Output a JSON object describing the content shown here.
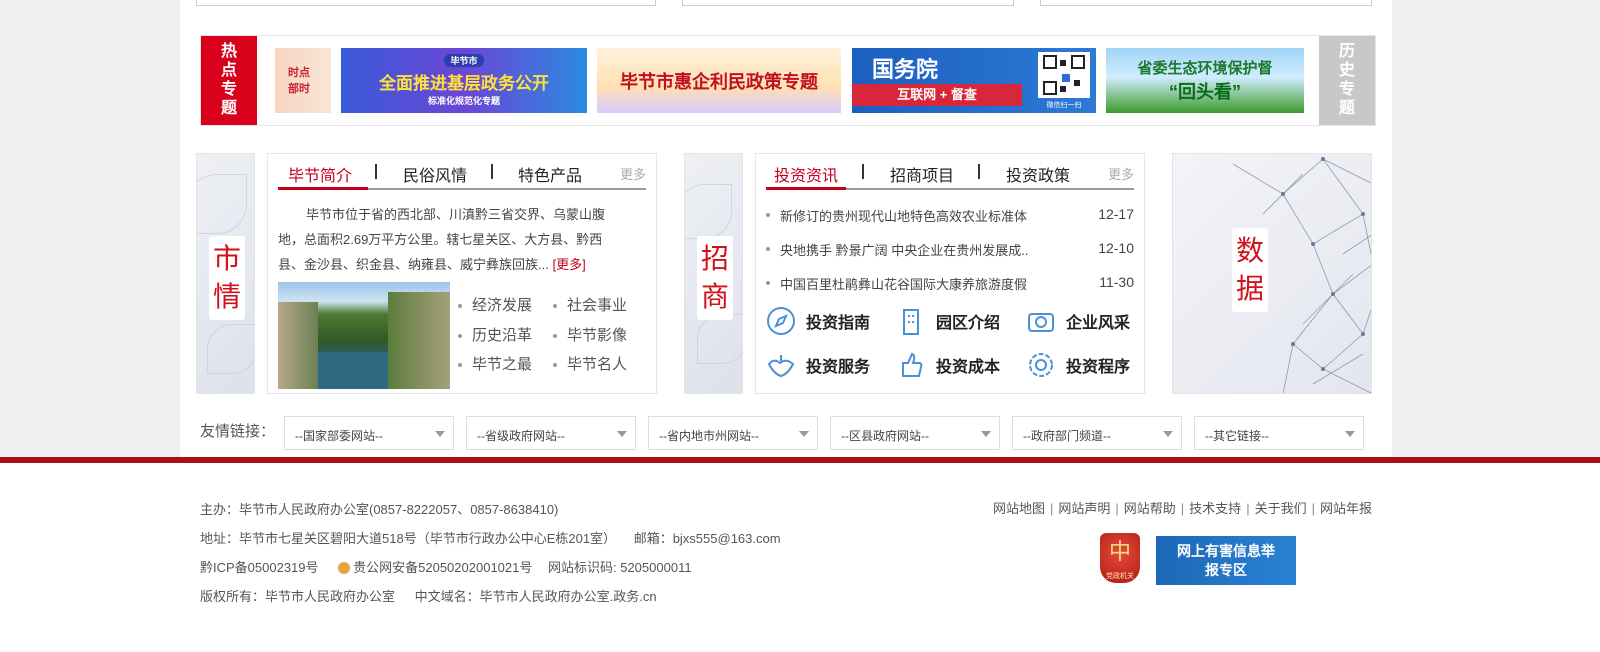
{
  "hot": {
    "label": "热点专题",
    "history_label": "历史专题",
    "banners": [
      {
        "text": "时点 部时"
      },
      {
        "tag": "毕节市",
        "text": "全面推进基层政务公开",
        "sub": "标准化规范化专题"
      },
      {
        "text": "毕节市惠企利民政策专题"
      },
      {
        "text": "国务院",
        "sub": "互联网 + 督查",
        "qr_note": "微信扫一扫"
      },
      {
        "text": "省委生态环境保护督",
        "sub": "“回头看”"
      }
    ]
  },
  "market": {
    "tag": "市情",
    "tabs": [
      "毕节简介",
      "民俗风情",
      "特色产品"
    ],
    "more": "更多",
    "intro": "毕节市位于省的西北部、川滇黔三省交界、乌蒙山腹地，总面积2.69万平方公里。辖七星关区、大方县、黔西县、金沙县、织金县、纳雍县、威宁彝族回族...",
    "intro_more": "[更多]",
    "links": [
      "经济发展",
      "社会事业",
      "历史沿革",
      "毕节影像",
      "毕节之最",
      "毕节名人"
    ]
  },
  "invest": {
    "tag": "招商",
    "tabs": [
      "投资资讯",
      "招商项目",
      "投资政策"
    ],
    "more": "更多",
    "news": [
      {
        "title": "新修订的贵州现代山地特色高效农业标准体",
        "date": "12-17"
      },
      {
        "title": "央地携手 黔景广阔 中央企业在贵州发展成..",
        "date": "12-10"
      },
      {
        "title": "中国百里杜鹃彝山花谷国际大康养旅游度假",
        "date": "11-30"
      }
    ],
    "shortcuts": [
      {
        "label": "投资指南",
        "icon": "compass-icon"
      },
      {
        "label": "园区介绍",
        "icon": "building-icon"
      },
      {
        "label": "企业风采",
        "icon": "camera-icon"
      },
      {
        "label": "投资服务",
        "icon": "handshake-icon"
      },
      {
        "label": "投资成本",
        "icon": "thumbs-up-icon"
      },
      {
        "label": "投资程序",
        "icon": "gear-icon"
      }
    ]
  },
  "data_section": {
    "tag": "数据"
  },
  "friend_links": {
    "label": "友情链接：",
    "selects": [
      "--国家部委网站--",
      "--省级政府网站--",
      "--省内地市州网站--",
      "--区县政府网站--",
      "--政府部门频道--",
      "--其它链接--"
    ]
  },
  "footer": {
    "host": "主办：毕节市人民政府办公室(0857-8222057、0857-8638410)",
    "address": "地址：毕节市七星关区碧阳大道518号（毕节市行政办公中心E栋201室）",
    "email": "邮箱：bjxs555@163.com",
    "icp": "黔ICP备05002319号",
    "police": "贵公网安备52050202001021号",
    "site_id": "网站标识码: 5205000011",
    "copyright": "版权所有：毕节市人民政府办公室",
    "domain": "中文域名：毕节市人民政府办公室.政务.cn",
    "links": [
      "网站地图",
      "网站声明",
      "网站帮助",
      "技术支持",
      "关于我们",
      "网站年报"
    ],
    "emblem_char": "中",
    "emblem_sub": "党政机关",
    "report_text": "网上有害信息举报专区"
  },
  "colors": {
    "brand_red": "#c4001a",
    "footer_bar": "#ac0d16"
  }
}
